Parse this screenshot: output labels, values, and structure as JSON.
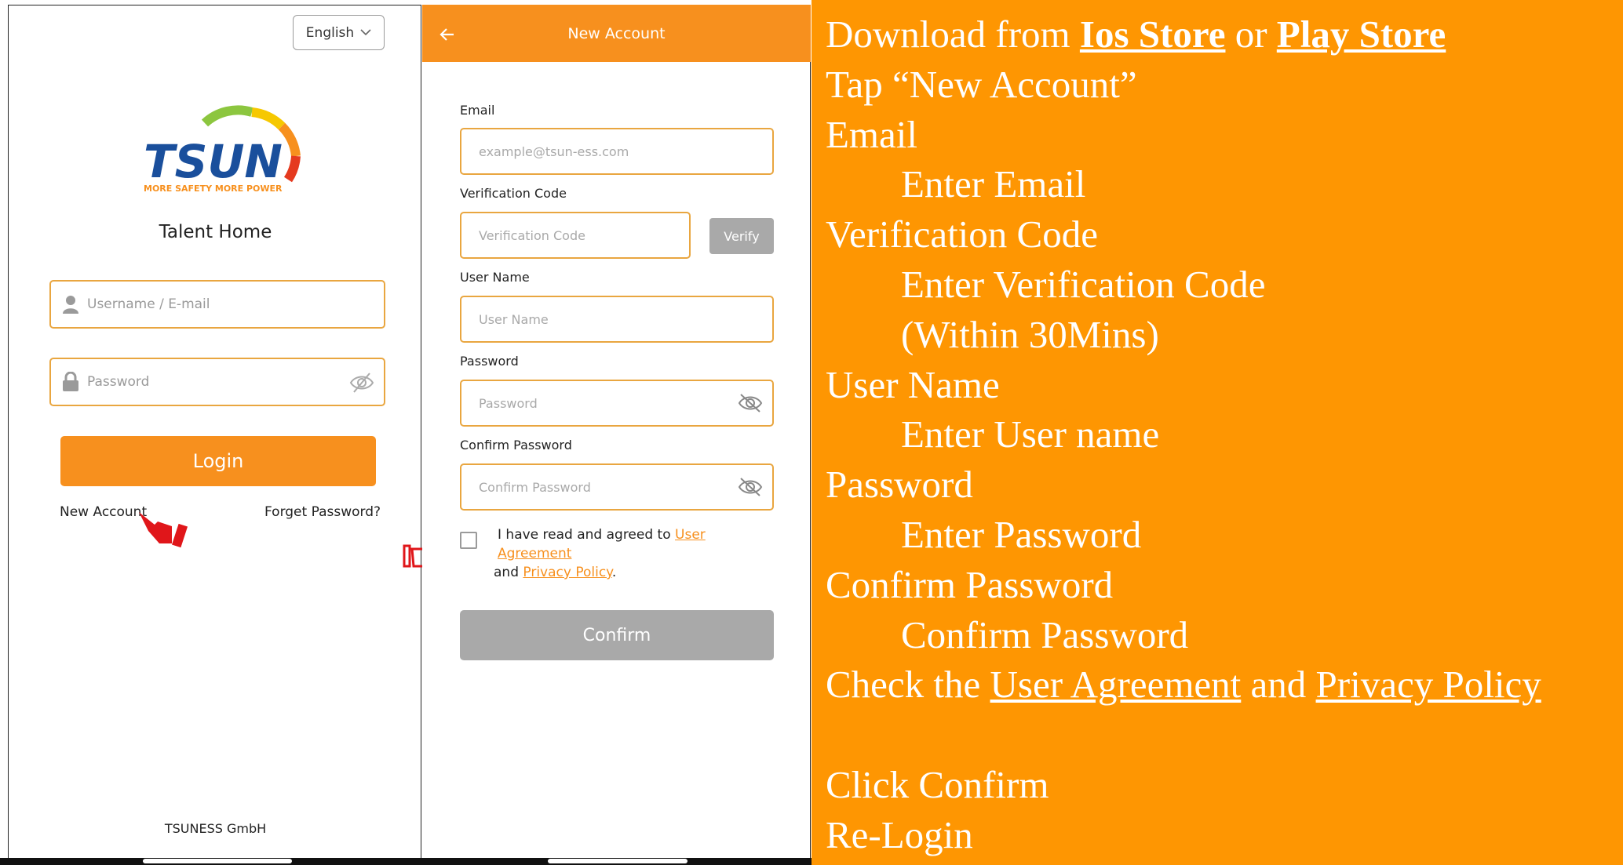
{
  "login": {
    "language": "English",
    "logo_text": "TSUN",
    "logo_tagline": "MORE SAFETY MORE POWER",
    "app_title": "Talent Home",
    "username_placeholder": "Username / E-mail",
    "password_placeholder": "Password",
    "login_label": "Login",
    "new_account_label": "New Account",
    "forget_password_label": "Forget Password?",
    "footer": "TSUNESS GmbH"
  },
  "new_account": {
    "title": "New Account",
    "back_icon": "arrow-left-icon",
    "email_label": "Email",
    "email_placeholder": "example@tsun-ess.com",
    "verification_label": "Verification Code",
    "verification_placeholder": "Verification Code",
    "verify_label": "Verify",
    "username_label": "User Name",
    "username_placeholder": "User Name",
    "password_label": "Password",
    "password_placeholder": "Password",
    "confirm_password_label": "Confirm Password",
    "confirm_password_placeholder": "Confirm Password",
    "agree_prefix": "I have read and agreed to ",
    "agree_user_agreement": "User Agreement",
    "agree_and": " and ",
    "agree_privacy": "Privacy Policy",
    "agree_suffix": ".",
    "confirm_label": "Confirm"
  },
  "instructions": {
    "l1_prefix": "Download from ",
    "l1_ios": "Ios Store",
    "l1_or": " or ",
    "l1_play": "Play Store",
    "l2": "Tap “New Account”",
    "l3": "Email",
    "l4": "Enter Email",
    "l5": "Verification Code",
    "l6": "Enter Verification Code",
    "l7": "(Within 30Mins)",
    "l8": "User Name",
    "l9": "Enter User name",
    "l10": "Password",
    "l11": "Enter Password",
    "l12": "Confirm Password",
    "l13": "Confirm Password",
    "l14_prefix": "Check the ",
    "l14_ua": "User Agreement",
    "l14_and": " and ",
    "l14_pp": "Privacy Policy",
    "l15": "Click Confirm",
    "l16": "Re-Login"
  },
  "colors": {
    "brand_orange": "#f7901e",
    "panel_orange": "#fe9602",
    "field_border": "#e9a640",
    "disabled_gray": "#a9a9a9",
    "pointer_red": "#e0161a"
  }
}
